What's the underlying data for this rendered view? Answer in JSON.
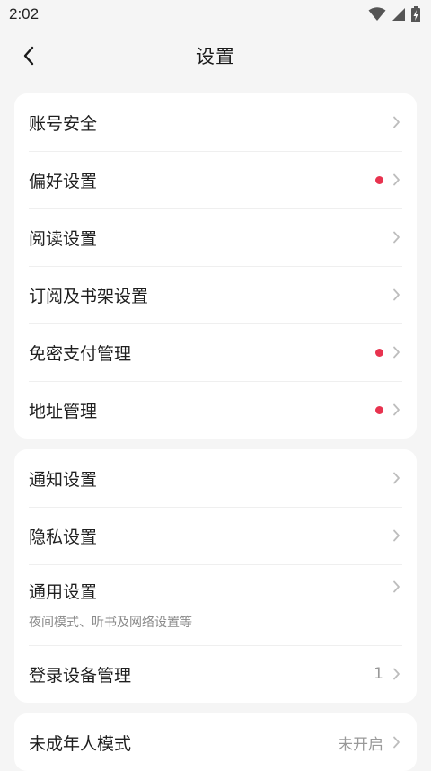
{
  "status": {
    "time": "2:02"
  },
  "header": {
    "title": "设置"
  },
  "colors": {
    "accent_dot": "#e8334f",
    "background": "#f5f5f5",
    "card": "#ffffff"
  },
  "icons": {
    "back": "chevron-left-icon",
    "row": "chevron-right-icon",
    "wifi": "wifi-icon",
    "signal": "signal-icon",
    "battery": "battery-charging-icon"
  },
  "groups": [
    {
      "items": [
        {
          "label": "账号安全",
          "red_dot": false
        },
        {
          "label": "偏好设置",
          "red_dot": true
        },
        {
          "label": "阅读设置",
          "red_dot": false
        },
        {
          "label": "订阅及书架设置",
          "red_dot": false
        },
        {
          "label": "免密支付管理",
          "red_dot": true
        },
        {
          "label": "地址管理",
          "red_dot": true
        }
      ]
    },
    {
      "items": [
        {
          "label": "通知设置"
        },
        {
          "label": "隐私设置"
        },
        {
          "label": "通用设置",
          "sublabel": "夜间模式、听书及网络设置等"
        },
        {
          "label": "登录设备管理",
          "value": "1"
        }
      ]
    },
    {
      "items": [
        {
          "label": "未成年人模式",
          "value": "未开启"
        }
      ]
    }
  ]
}
